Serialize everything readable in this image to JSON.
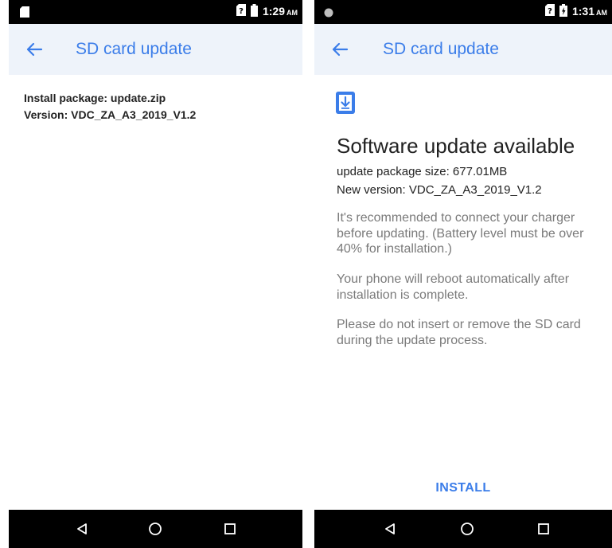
{
  "left_screen": {
    "status_bar": {
      "time": "1:29",
      "ampm": "AM"
    },
    "app_bar": {
      "title": "SD card update"
    },
    "info": {
      "package_line": "Install package: update.zip",
      "version_line": "Version: VDC_ZA_A3_2019_V1.2"
    }
  },
  "right_screen": {
    "status_bar": {
      "time": "1:31",
      "ampm": "AM"
    },
    "app_bar": {
      "title": "SD card update"
    },
    "update": {
      "title": "Software update available",
      "size_line": "update package size: 677.01MB",
      "version_line": "New version: VDC_ZA_A3_2019_V1.2",
      "note_charger": "It's recommended to connect your charger before updating. (Battery level must be over 40% for installation.)",
      "note_reboot": "Your phone will reboot automatically after installation is complete.",
      "note_sdcard": "Please do not insert or remove the SD card during the update process.",
      "install_label": "INSTALL"
    }
  },
  "colors": {
    "accent": "#3b7de9",
    "app_bar_bg": "#eef3fa",
    "system_bar_bg": "#000000",
    "note_text": "#7a7a7a"
  }
}
